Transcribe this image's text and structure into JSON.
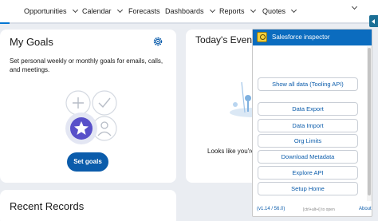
{
  "nav": {
    "items": [
      {
        "label": "Opportunities",
        "has_menu": true
      },
      {
        "label": "Calendar",
        "has_menu": true
      },
      {
        "label": "Forecasts",
        "has_menu": false
      },
      {
        "label": "Dashboards",
        "has_menu": true
      },
      {
        "label": "Reports",
        "has_menu": true
      },
      {
        "label": "Quotes",
        "has_menu": true
      }
    ],
    "more_icon": "chevron-down-icon"
  },
  "goals": {
    "title": "My Goals",
    "settings_icon": "gear-icon",
    "description": "Set personal weekly or monthly goals for emails, calls, and meetings.",
    "button_label": "Set goals",
    "illustration_icons": [
      "plus-icon",
      "check-icon",
      "star-icon",
      "person-icon"
    ]
  },
  "events": {
    "title": "Today's Events",
    "empty_text": "Looks like you're"
  },
  "recent": {
    "title": "Recent Records"
  },
  "inspector": {
    "title": "Salesforce inspector",
    "buttons": [
      {
        "label": "Show all data (Tooling API)"
      },
      {
        "label": "Data Export"
      },
      {
        "label": "Data Import"
      },
      {
        "label": "Org Limits"
      },
      {
        "label": "Download Metadata"
      },
      {
        "label": "Explore API"
      },
      {
        "label": "Setup Home"
      }
    ],
    "version": "(v1.14 / 56.0)",
    "shortcut_hint": "[ctrl+alt+i] to open",
    "about_label": "About"
  },
  "colors": {
    "brand_blue": "#0b5cab",
    "inspector_header": "#0b6cbf",
    "page_bg": "#eaedf2"
  }
}
